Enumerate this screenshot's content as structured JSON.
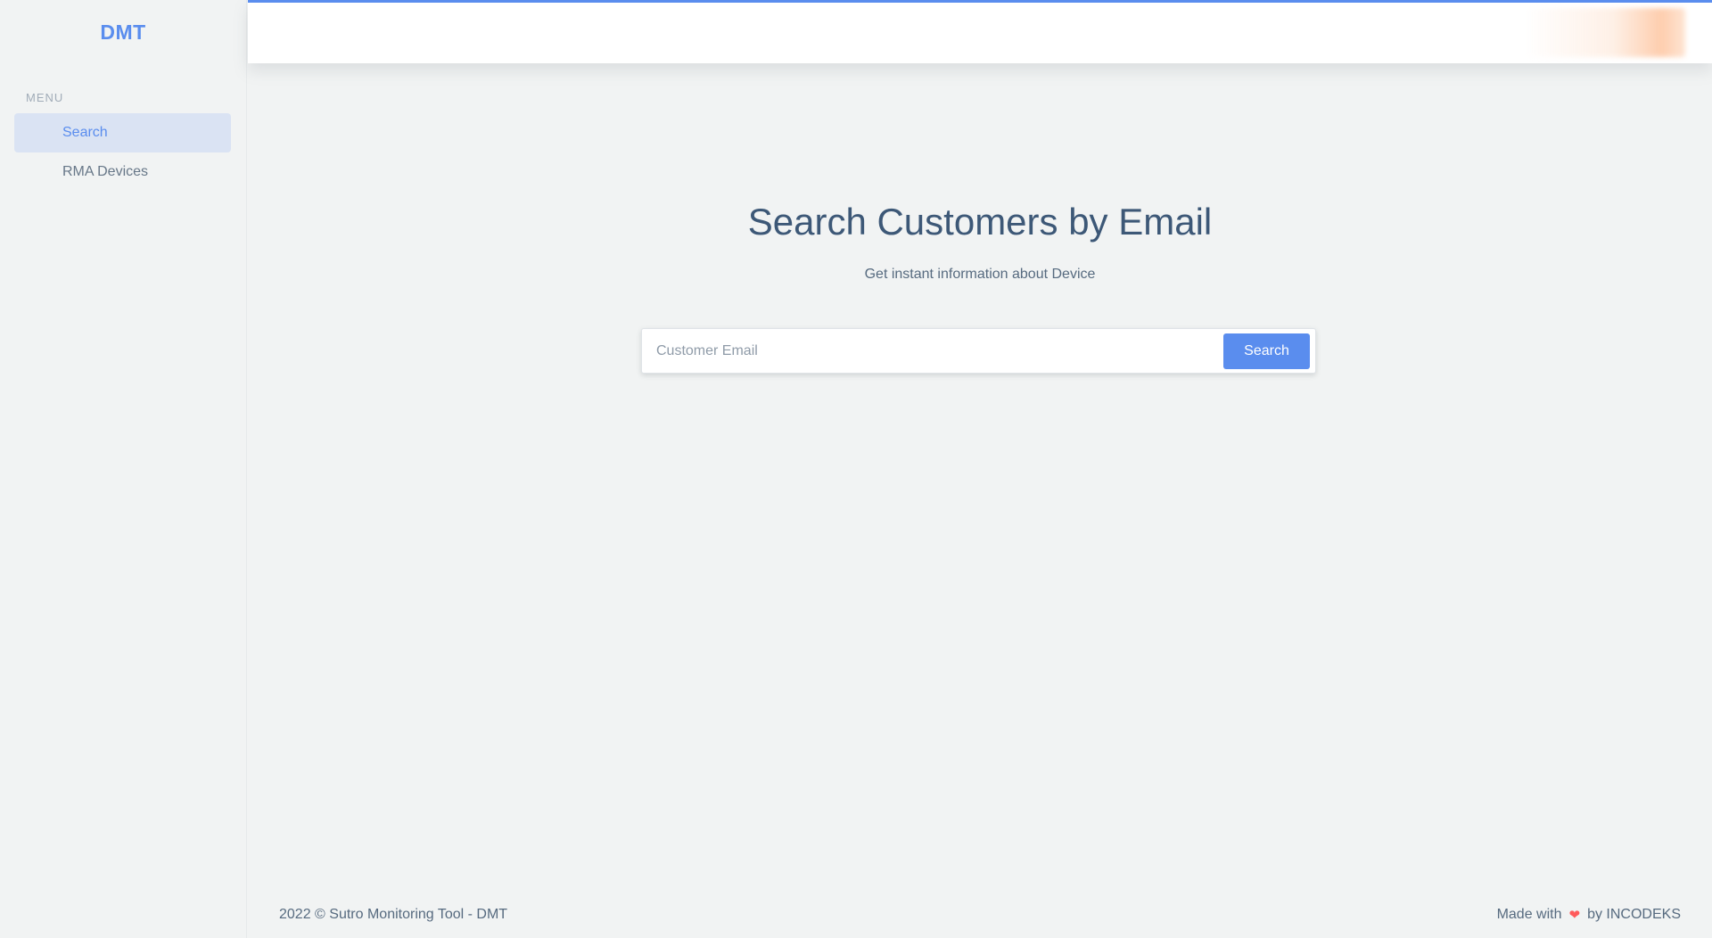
{
  "brand": {
    "name": "DMT"
  },
  "sidebar": {
    "menu_header": "MENU",
    "items": [
      {
        "label": "Search",
        "active": true
      },
      {
        "label": "RMA Devices",
        "active": false
      }
    ]
  },
  "main": {
    "title": "Search Customers by Email",
    "subtitle": "Get instant information about Device",
    "search": {
      "placeholder": "Customer Email",
      "value": "",
      "button_label": "Search"
    }
  },
  "footer": {
    "copyright": "2022 © Sutro Monitoring Tool - DMT",
    "made_with": "Made with",
    "heart_icon": "❤",
    "by": "by INCODEKS"
  },
  "colors": {
    "accent": "#5a8dee",
    "heart": "#ff5b5c",
    "active_bg": "#dae3f3",
    "page_bg": "#f1f3f3"
  }
}
